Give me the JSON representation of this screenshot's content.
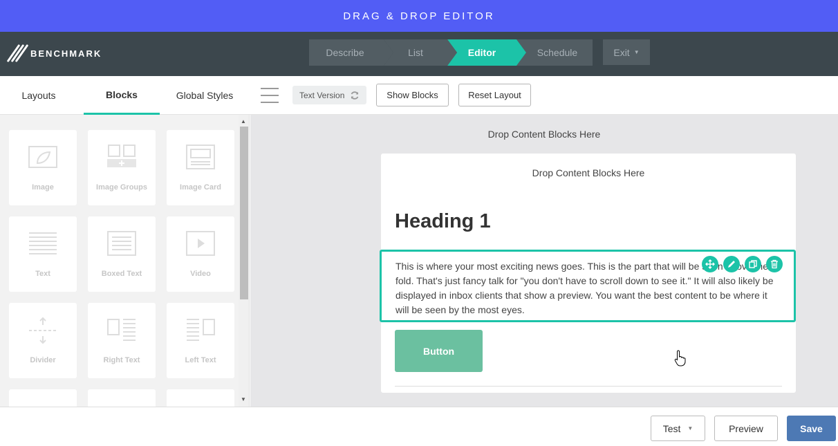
{
  "app": {
    "title": "DRAG & DROP EDITOR",
    "brand": "BENCHMARK"
  },
  "steps": [
    {
      "label": "Describe",
      "active": false
    },
    {
      "label": "List",
      "active": false
    },
    {
      "label": "Editor",
      "active": true
    },
    {
      "label": "Schedule",
      "active": false
    }
  ],
  "exit": {
    "label": "Exit"
  },
  "tabs": [
    {
      "label": "Layouts"
    },
    {
      "label": "Blocks"
    },
    {
      "label": "Global Styles"
    }
  ],
  "toolbar": {
    "text_version": "Text Version",
    "show_blocks": "Show Blocks",
    "reset_layout": "Reset Layout"
  },
  "blocks": [
    {
      "label": "Image"
    },
    {
      "label": "Image Groups"
    },
    {
      "label": "Image Card"
    },
    {
      "label": "Text"
    },
    {
      "label": "Boxed Text"
    },
    {
      "label": "Video"
    },
    {
      "label": "Divider"
    },
    {
      "label": "Right Text"
    },
    {
      "label": "Left Text"
    }
  ],
  "canvas": {
    "drop_outer": "Drop Content Blocks Here",
    "drop_inner": "Drop Content Blocks Here",
    "heading": "Heading 1",
    "body": "This is where your most exciting news goes. This is the part that will be seen above the fold. That's just fancy talk for \"you don't have to scroll down to see it.\" It will also likely be displayed in inbox clients that show a preview. You want the best content to be where it will be seen by the most eyes.",
    "button": "Button"
  },
  "footer": {
    "test": "Test",
    "preview": "Preview",
    "save": "Save"
  },
  "colors": {
    "title_bar": "#525df5",
    "header": "#3c474d",
    "accent": "#1cc3a8",
    "save": "#4d79b4",
    "email_button": "#6bc0a0"
  }
}
